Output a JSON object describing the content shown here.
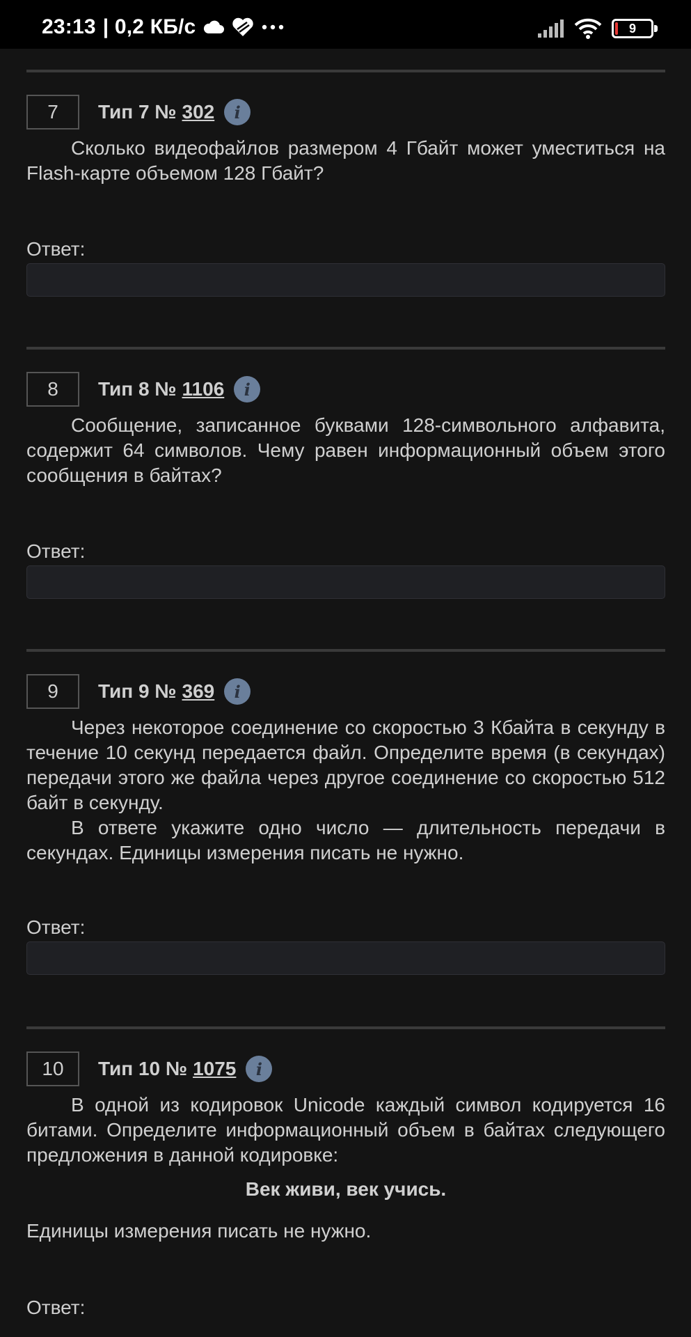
{
  "status": {
    "time": "23:13",
    "network_speed": "| 0,2 КБ/с",
    "battery": "9",
    "icons": [
      "cloud-icon",
      "heart-icon",
      "more-dots-icon",
      "signal-icon",
      "wifi-icon",
      "battery-icon"
    ]
  },
  "tasks": [
    {
      "number": "7",
      "type_prefix": "Тип 7 №",
      "type_id": "302",
      "paragraphs": [
        "Сколько видеофайлов размером 4 Гбайт может уместить­ся на Flash-карте объемом 128 Гбайт?"
      ],
      "answer_label": "Ответ:"
    },
    {
      "number": "8",
      "type_prefix": "Тип 8 №",
      "type_id": "1106",
      "paragraphs": [
        "Сообщение, записанное буквами 128-символьного алфави­та, содержит 64 символов. Чему равен информационный объем этого сообщения в байтах?"
      ],
      "answer_label": "Ответ:"
    },
    {
      "number": "9",
      "type_prefix": "Тип 9 №",
      "type_id": "369",
      "paragraphs": [
        "Через некоторое соединение со скоростью 3 Кбайта в се­кунду в течение 10 секунд передается файл. Определите время (в секундах) передачи этого же файла через другое соединение со скоростью 512 байт в секунду.",
        "В ответе укажите одно число — длительность передачи в секундах. Единицы измерения писать не нужно."
      ],
      "answer_label": "Ответ:"
    },
    {
      "number": "10",
      "type_prefix": "Тип 10 №",
      "type_id": "1075",
      "paragraphs": [
        "В одной из кодировок Unicode каждый символ кодируется 16 битами. Определите информационный объем в байтах сле­дующего предложения в данной кодировке:"
      ],
      "quote": "Век живи, век учись.",
      "note": "Единицы измерения писать не нужно.",
      "answer_label": "Ответ:"
    }
  ]
}
